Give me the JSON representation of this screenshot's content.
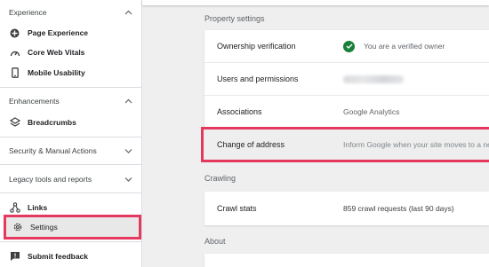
{
  "sidebar": {
    "experience": {
      "title": "Experience",
      "items": [
        {
          "label": "Page Experience",
          "icon": "page-experience-icon"
        },
        {
          "label": "Core Web Vitals",
          "icon": "speedometer-icon"
        },
        {
          "label": "Mobile Usability",
          "icon": "mobile-icon"
        }
      ]
    },
    "enhancements": {
      "title": "Enhancements",
      "items": [
        {
          "label": "Breadcrumbs",
          "icon": "layers-icon"
        }
      ]
    },
    "security": {
      "title": "Security & Manual Actions"
    },
    "legacy": {
      "title": "Legacy tools and reports"
    },
    "bottom_items": [
      {
        "label": "Links",
        "icon": "links-icon"
      },
      {
        "label": "Settings",
        "icon": "gear-icon"
      },
      {
        "label": "Submit feedback",
        "icon": "feedback-icon"
      }
    ]
  },
  "main": {
    "property_settings": {
      "title": "Property settings",
      "rows": [
        {
          "key": "Ownership verification",
          "value": "You are a verified owner"
        },
        {
          "key": "Users and permissions",
          "value": ""
        },
        {
          "key": "Associations",
          "value": "Google Analytics"
        },
        {
          "key": "Change of address",
          "value": "Inform Google when your site moves to a new"
        }
      ]
    },
    "crawling": {
      "title": "Crawling",
      "rows": [
        {
          "key": "Crawl stats",
          "value": "859 crawl requests (last 90 days)"
        }
      ]
    },
    "about": {
      "title": "About"
    }
  },
  "colors": {
    "accent_highlight": "#e5385e",
    "verified_green": "#188038"
  }
}
